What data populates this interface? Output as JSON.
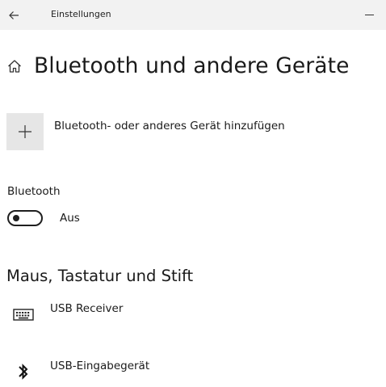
{
  "window": {
    "title": "Einstellungen",
    "back_icon": "back-arrow-icon",
    "minimize_icon": "minimize-icon"
  },
  "page": {
    "title": "Bluetooth und andere Geräte",
    "home_icon": "home-icon"
  },
  "add_device": {
    "label": "Bluetooth- oder anderes Gerät hinzufügen",
    "icon": "plus-icon"
  },
  "bluetooth": {
    "label": "Bluetooth",
    "toggle_state": "Aus",
    "enabled": false
  },
  "section": {
    "heading": "Maus, Tastatur und Stift",
    "devices": [
      {
        "name": "USB Receiver",
        "icon": "keyboard-icon"
      },
      {
        "name": "USB-Eingabegerät",
        "icon": "bluetooth-icon"
      }
    ]
  }
}
